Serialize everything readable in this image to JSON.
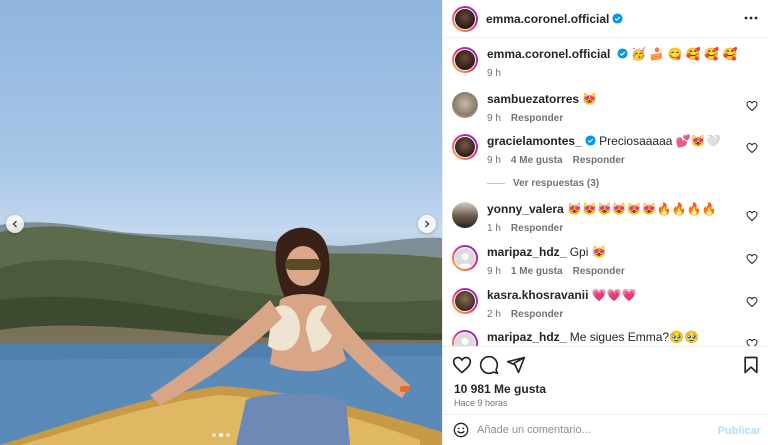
{
  "post": {
    "author": "emma.coronel.official",
    "caption_emojis": "🥳 🍰 😋 🥰 🥰 🥰",
    "caption_time": "9 h",
    "carousel_index": 2,
    "carousel_count": 3
  },
  "comments": [
    {
      "user": "sambuezatorres",
      "text": "😻",
      "time": "9 h",
      "likes": "",
      "reply": "Responder",
      "verified": false,
      "ring": false
    },
    {
      "user": "gracielamontes_",
      "text": "Preciosaaaaa 💕😻🤍",
      "time": "9 h",
      "likes": "4 Me gusta",
      "reply": "Responder",
      "verified": true,
      "ring": true
    },
    {
      "user": "yonny_valera",
      "text": "😻😻😻😻😻😻🔥🔥🔥🔥",
      "time": "1 h",
      "likes": "",
      "reply": "Responder",
      "verified": false,
      "ring": false
    },
    {
      "user": "maripaz_hdz_",
      "text": "Gpi 😻",
      "time": "9 h",
      "likes": "1 Me gusta",
      "reply": "Responder",
      "verified": false,
      "ring": true
    },
    {
      "user": "kasra.khosravanii",
      "text": "💗💗💗",
      "time": "2 h",
      "likes": "",
      "reply": "Responder",
      "verified": false,
      "ring": true
    },
    {
      "user": "maripaz_hdz_",
      "text": "Me sigues Emma?🥹🥹",
      "time": "",
      "likes": "",
      "reply": "",
      "verified": false,
      "ring": true
    }
  ],
  "replies_label": "Ver respuestas (3)",
  "likes_count": "10 981 Me gusta",
  "posted_time": "Hace 9 horas",
  "composer": {
    "placeholder": "Añade un comentario...",
    "publish_label": "Publicar"
  },
  "icons": [
    "more-icon",
    "heart-icon",
    "comment-icon",
    "share-icon",
    "bookmark-icon",
    "emoji-icon",
    "chevron-left-icon",
    "chevron-right-icon",
    "verified-icon"
  ],
  "colors": {
    "verified": "#0095f6",
    "publish_disabled": "#b2dffc",
    "muted": "#737373"
  }
}
